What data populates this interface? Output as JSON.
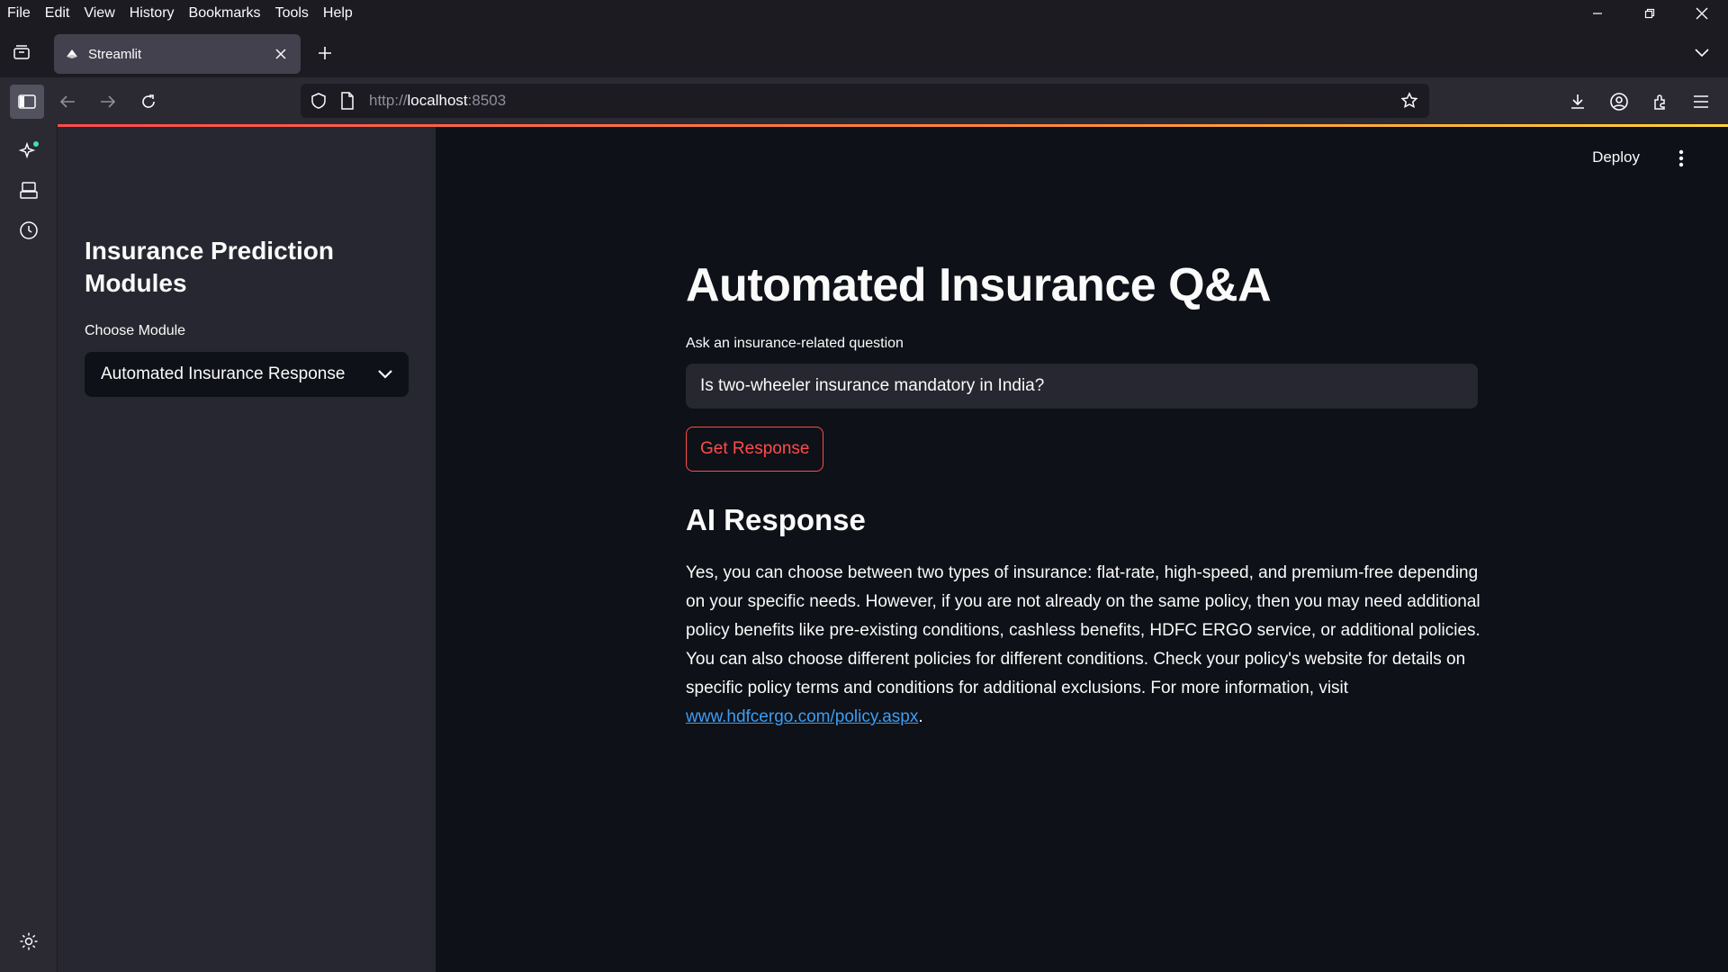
{
  "menubar": {
    "items": [
      "File",
      "Edit",
      "View",
      "History",
      "Bookmarks",
      "Tools",
      "Help"
    ]
  },
  "tab": {
    "title": "Streamlit"
  },
  "url": {
    "scheme": "http://",
    "host": "localhost",
    "port": ":8503"
  },
  "sidebar": {
    "title": "Insurance Prediction Modules",
    "select_label": "Choose Module",
    "selected_module": "Automated Insurance Response"
  },
  "header": {
    "deploy_label": "Deploy"
  },
  "main": {
    "title": "Automated Insurance Q&A",
    "question_label": "Ask an insurance-related question",
    "question_value": "Is two-wheeler insurance mandatory in India?",
    "button_label": "Get Response",
    "response_title": "AI Response",
    "response_text": "Yes, you can choose between two types of insurance: flat-rate, high-speed, and premium-free depending on your specific needs. However, if you are not already on the same policy, then you may need additional policy benefits like pre-existing conditions, cashless benefits, HDFC ERGO service, or additional policies. You can also choose different policies for different conditions. Check your policy's website for details on specific policy terms and conditions for additional exclusions. For more information, visit ",
    "response_link": "www.hdfcergo.com/policy.aspx",
    "response_tail": "."
  },
  "colors": {
    "accent": "#ff4b4b",
    "link": "#3d9df3",
    "background": "#0e1117",
    "sidebar": "#262730"
  },
  "icons": [
    "tab-list-icon",
    "streamlit-favicon",
    "close-icon",
    "plus-icon",
    "chevron-down-icon",
    "sidebar-toggle-icon",
    "back-icon",
    "forward-icon",
    "reload-icon",
    "shield-icon",
    "page-icon",
    "star-icon",
    "download-icon",
    "account-icon",
    "extensions-icon",
    "hamburger-icon",
    "ai-sparkle-icon",
    "synced-tabs-icon",
    "history-icon",
    "settings-icon",
    "kebab-icon"
  ]
}
